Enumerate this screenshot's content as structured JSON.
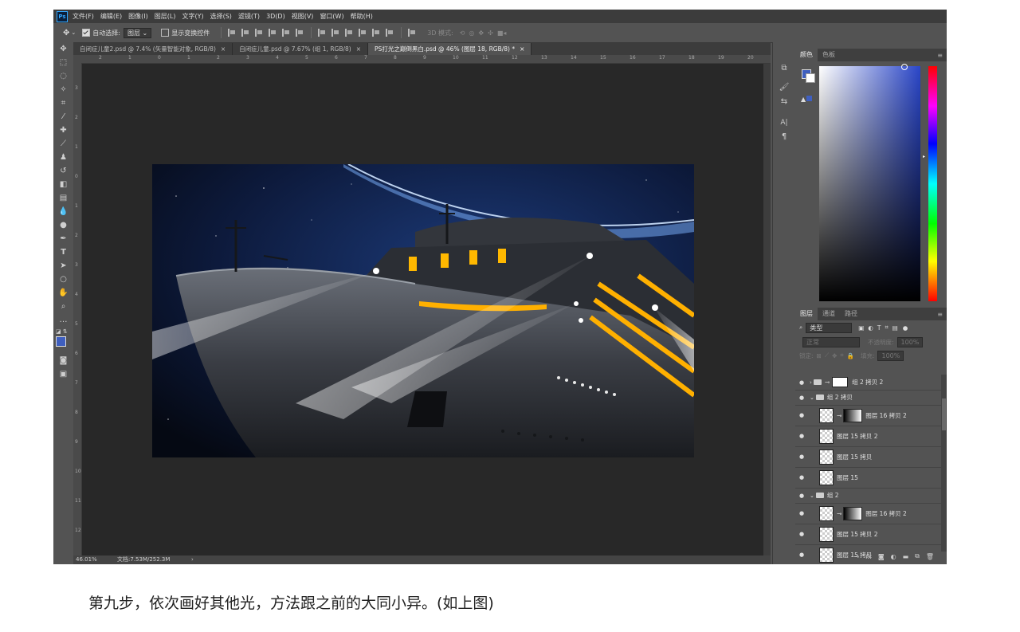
{
  "menubar": {
    "logo": "Ps",
    "items": [
      "文件(F)",
      "编辑(E)",
      "图像(I)",
      "图层(L)",
      "文字(Y)",
      "选择(S)",
      "滤镜(T)",
      "3D(D)",
      "视图(V)",
      "窗口(W)",
      "帮助(H)"
    ]
  },
  "options": {
    "auto_select_label": "自动选择:",
    "auto_select_value": "图层",
    "show_transform_label": "显示变换控件",
    "mode_label": "3D 模式:"
  },
  "tabs": [
    {
      "label": "自闭症儿童2.psd @ 7.4% (矢量智能对象, RGB/8)",
      "close": "×"
    },
    {
      "label": "自闭症儿童.psd @ 7.67% (组 1, RGB/8)",
      "close": "×"
    },
    {
      "label": "PS打光之巅倒黑白.psd @ 46% (图层 18, RGB/8) *",
      "close": "×"
    }
  ],
  "ruler_h": [
    "2",
    "1",
    "0",
    "1",
    "2",
    "3",
    "4",
    "5",
    "6",
    "7",
    "8",
    "9",
    "10",
    "11",
    "12",
    "13",
    "14",
    "15",
    "16",
    "17",
    "18",
    "19",
    "20"
  ],
  "ruler_v": [
    "3",
    "2",
    "1",
    "0",
    "1",
    "2",
    "3",
    "4",
    "5",
    "6",
    "7",
    "8",
    "9",
    "10",
    "11",
    "12"
  ],
  "status": {
    "zoom": "46.01%",
    "doc": "文档:7.53M/252.3M"
  },
  "color_panel": {
    "tabs": [
      "颜色",
      "色板"
    ],
    "fg": "#3f5fbf",
    "bg": "#ffffff"
  },
  "layers_panel": {
    "tabs": [
      "图层",
      "通道",
      "路径"
    ],
    "filter_label": "类型",
    "blend_mode": "正常",
    "opacity_label": "不透明度:",
    "opacity_value": "100%",
    "lock_label": "锁定:",
    "fill_label": "填充:",
    "fill_value": "100%",
    "rows": [
      {
        "name": "组 2 拷贝 2",
        "kind": "group-collapsed"
      },
      {
        "name": "组 2 拷贝",
        "kind": "group-open"
      },
      {
        "name": "图层 16 拷贝 2",
        "kind": "masked"
      },
      {
        "name": "图层 15 拷贝 2",
        "kind": "layer"
      },
      {
        "name": "图层 15 拷贝",
        "kind": "layer"
      },
      {
        "name": "图层 15",
        "kind": "layer"
      },
      {
        "name": "组 2",
        "kind": "group-open"
      },
      {
        "name": "图层 16 拷贝 2",
        "kind": "masked"
      },
      {
        "name": "图层 15 拷贝 2",
        "kind": "layer"
      },
      {
        "name": "图层 15 拷贝",
        "kind": "layer"
      }
    ],
    "footer_icons": [
      "link-icon",
      "fx-icon",
      "mask-icon",
      "adjustment-icon",
      "folder-icon",
      "new-layer-icon",
      "trash-icon"
    ]
  },
  "caption": "第九步，依次画好其他光，方法跟之前的大同小异。(如上图)"
}
